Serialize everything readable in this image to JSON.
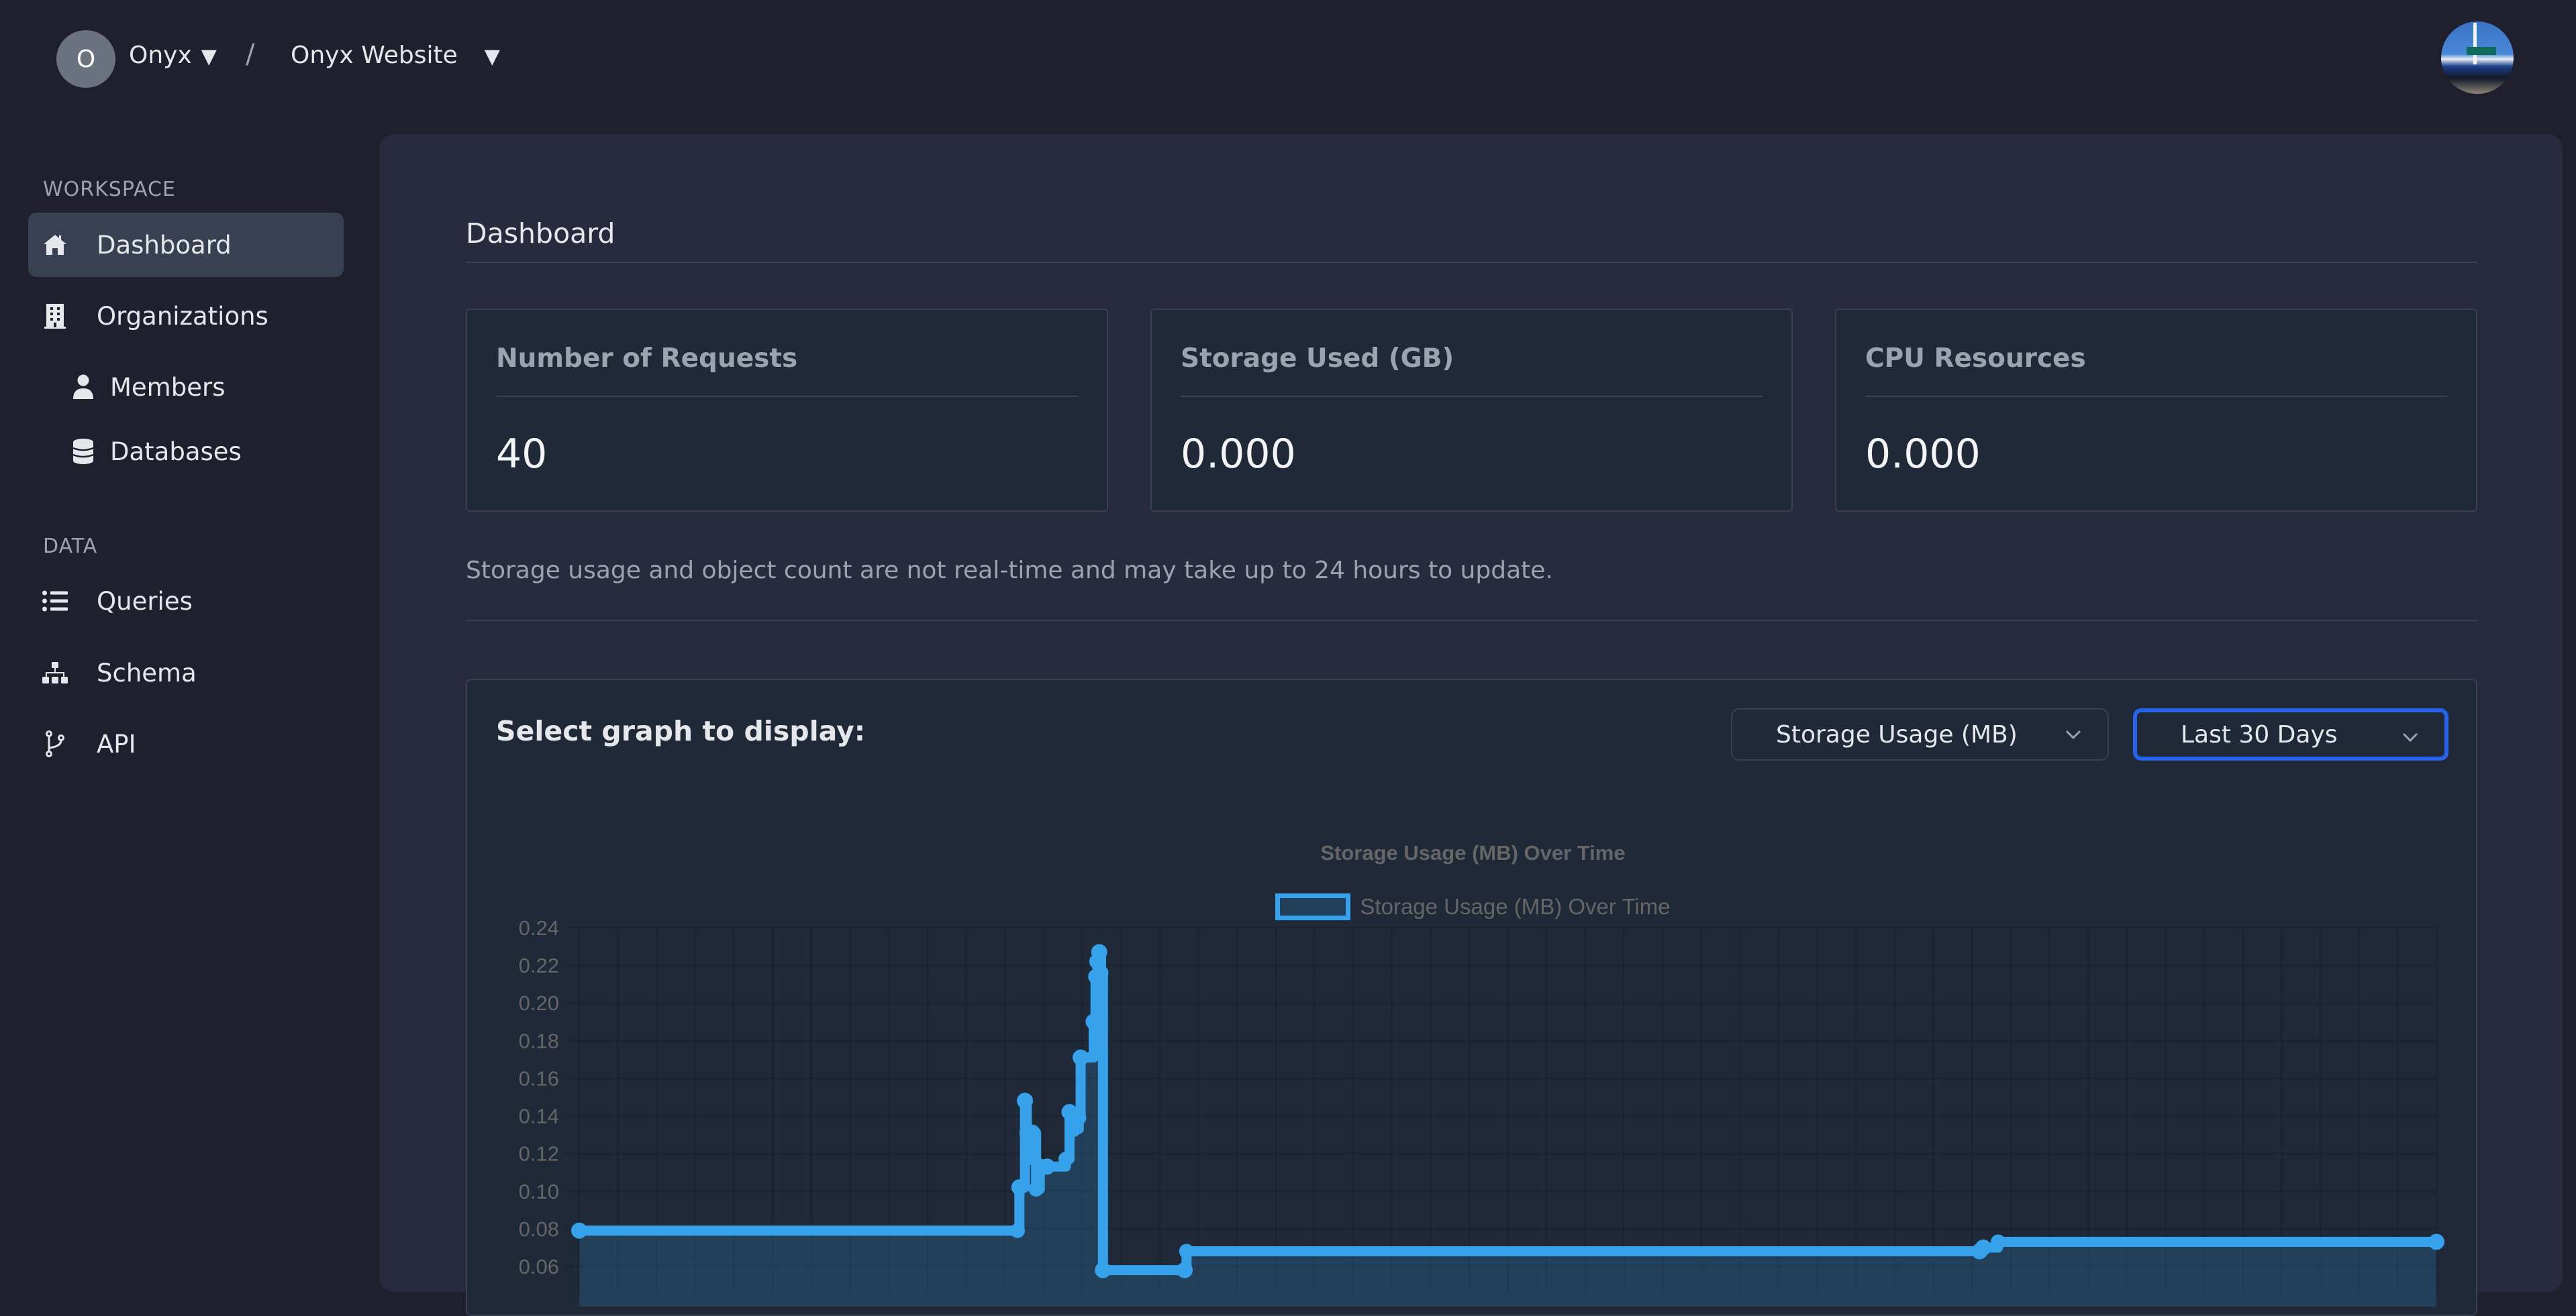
{
  "header": {
    "org_initial": "O",
    "org_name": "Onyx",
    "separator": "/",
    "project_name": "Onyx Website",
    "caret": "▼",
    "user_avatar": "sailboat-photo"
  },
  "sidebar": {
    "sections": [
      {
        "label": "WORKSPACE",
        "items": [
          {
            "label": "Dashboard",
            "icon": "home-icon",
            "active": true
          },
          {
            "label": "Organizations",
            "icon": "building-icon",
            "active": false
          },
          {
            "label": "Members",
            "icon": "user-icon",
            "active": false,
            "sub": true
          },
          {
            "label": "Databases",
            "icon": "database-icon",
            "active": false,
            "sub": true
          }
        ]
      },
      {
        "label": "DATA",
        "items": [
          {
            "label": "Queries",
            "icon": "list-icon",
            "active": false
          },
          {
            "label": "Schema",
            "icon": "sitemap-icon",
            "active": false
          },
          {
            "label": "API",
            "icon": "code-branch-icon",
            "active": false
          }
        ]
      }
    ]
  },
  "main": {
    "title": "Dashboard",
    "cards": [
      {
        "title": "Number of Requests",
        "value": "40"
      },
      {
        "title": "Storage Used (GB)",
        "value": "0.000"
      },
      {
        "title": "CPU Resources",
        "value": "0.000"
      }
    ],
    "note": "Storage usage and object count are not real-time and may take up to 24 hours to update.",
    "graph": {
      "select_label": "Select graph to display:",
      "metric_selected": "Storage Usage (MB)",
      "range_selected": "Last 30 Days"
    }
  },
  "colors": {
    "accent": "#36a2eb",
    "focus_ring": "#2563eb",
    "background": "#1f1f2e",
    "panel": "#282a3e",
    "card": "#1f2937"
  },
  "chart_data": {
    "type": "line",
    "stepped": true,
    "filled": true,
    "title": "Storage Usage (MB) Over Time",
    "legend": [
      "Storage Usage (MB) Over Time"
    ],
    "legend_position": "top",
    "xlabel": "",
    "ylabel": "",
    "ylim": [
      0.06,
      0.24
    ],
    "y_ticks": [
      "0.24",
      "0.22",
      "0.20",
      "0.18",
      "0.16",
      "0.14",
      "0.12",
      "0.10",
      "0.08",
      "0.06"
    ],
    "grid": true,
    "x_tick_count": 48,
    "series": [
      {
        "name": "Storage Usage (MB) Over Time",
        "color": "#36a2eb",
        "points": [
          {
            "x": 0.0,
            "y": 0.079
          },
          {
            "x": 11.8,
            "y": 0.079
          },
          {
            "x": 11.85,
            "y": 0.102
          },
          {
            "x": 12.0,
            "y": 0.148
          },
          {
            "x": 12.05,
            "y": 0.131
          },
          {
            "x": 12.1,
            "y": 0.118
          },
          {
            "x": 12.2,
            "y": 0.131
          },
          {
            "x": 12.3,
            "y": 0.101
          },
          {
            "x": 12.4,
            "y": 0.113
          },
          {
            "x": 12.6,
            "y": 0.113
          },
          {
            "x": 13.1,
            "y": 0.117
          },
          {
            "x": 13.2,
            "y": 0.142
          },
          {
            "x": 13.3,
            "y": 0.133
          },
          {
            "x": 13.45,
            "y": 0.139
          },
          {
            "x": 13.5,
            "y": 0.171
          },
          {
            "x": 13.85,
            "y": 0.19
          },
          {
            "x": 13.9,
            "y": 0.214
          },
          {
            "x": 13.95,
            "y": 0.222
          },
          {
            "x": 14.0,
            "y": 0.227
          },
          {
            "x": 14.05,
            "y": 0.216
          },
          {
            "x": 14.1,
            "y": 0.058
          },
          {
            "x": 16.3,
            "y": 0.058
          },
          {
            "x": 16.35,
            "y": 0.068
          },
          {
            "x": 37.7,
            "y": 0.068
          },
          {
            "x": 37.8,
            "y": 0.07
          },
          {
            "x": 38.2,
            "y": 0.073
          },
          {
            "x": 50.0,
            "y": 0.073
          }
        ]
      }
    ]
  }
}
